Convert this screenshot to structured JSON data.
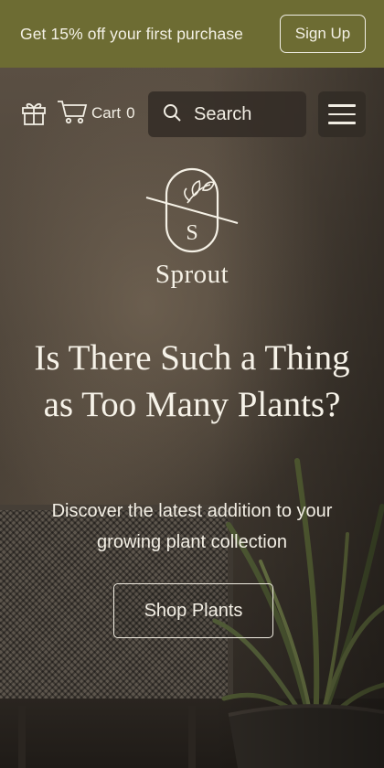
{
  "promo": {
    "text": "Get 15% off your first purchase",
    "signup_label": "Sign Up"
  },
  "nav": {
    "gift_icon": "gift-icon",
    "cart_icon": "cart-icon",
    "cart_label": "Cart",
    "cart_count": "0",
    "search_icon": "search-icon",
    "search_label": "Search",
    "menu_icon": "hamburger-menu-icon"
  },
  "logo": {
    "monogram": "S",
    "brand_name": "Sprout"
  },
  "hero": {
    "headline": "Is There Such a Thing as Too Many Plants?",
    "subtext": "Discover the latest addition to your growing plant collection",
    "cta_label": "Shop Plants"
  },
  "colors": {
    "promo_bar": "#6d6c33",
    "text_light": "#f4f1e6",
    "nav_bg": "#322c26"
  }
}
